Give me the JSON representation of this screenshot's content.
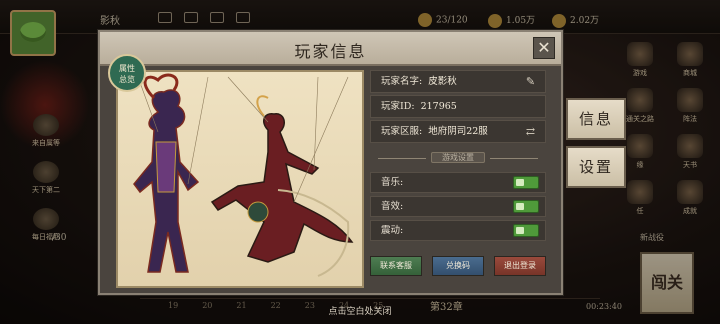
{
  "top_bar": {
    "player_name_short": "影秋",
    "resource_1": "23/120",
    "resource_2": "1.05万",
    "resource_3": "2.02万"
  },
  "left_menu": [
    {
      "label": "来自属等"
    },
    {
      "label": "天下第二"
    },
    {
      "label": "每日福利"
    }
  ],
  "left_count": "/30",
  "right_menu": [
    {
      "label": "游戏"
    },
    {
      "label": "商城"
    },
    {
      "label": "通关之路"
    },
    {
      "label": "阵法"
    },
    {
      "label": "缘"
    },
    {
      "label": "天书"
    },
    {
      "label": "任"
    },
    {
      "label": "成就"
    }
  ],
  "bottom": {
    "ticks": [
      "19",
      "20",
      "21",
      "22",
      "23",
      "24",
      "25"
    ],
    "stage": "第32章",
    "timer": "00:23:40",
    "right_text": "新战役",
    "big_button": "闯关"
  },
  "modal": {
    "title": "玩家信息",
    "badge_line1": "属性",
    "badge_line2": "总览",
    "rows": [
      {
        "label": "玩家名字:",
        "value": "皮影秋",
        "icon": "edit-icon"
      },
      {
        "label": "玩家ID:",
        "value": "217965",
        "icon": ""
      },
      {
        "label": "玩家区服:",
        "value": "地府阴司22服",
        "icon": "switch-icon"
      }
    ],
    "settings_title": "游戏设置",
    "toggles": [
      {
        "label": "音乐:",
        "on": true
      },
      {
        "label": "音效:",
        "on": true
      },
      {
        "label": "震动:",
        "on": true
      }
    ],
    "buttons": {
      "contact": "联系客服",
      "redeem": "兑换码",
      "logout": "退出登录"
    }
  },
  "side_tabs": {
    "info": "信息",
    "settings": "设置"
  },
  "footer_hint": "点击空白处关闭",
  "colors": {
    "panel_bg": "#4a443e",
    "header_bg": "#cfc6b6",
    "toggle_on": "#4f9a3a",
    "btn_green": "#4e7d52",
    "btn_blue": "#4a6c8f",
    "btn_red": "#9a4a3c"
  }
}
